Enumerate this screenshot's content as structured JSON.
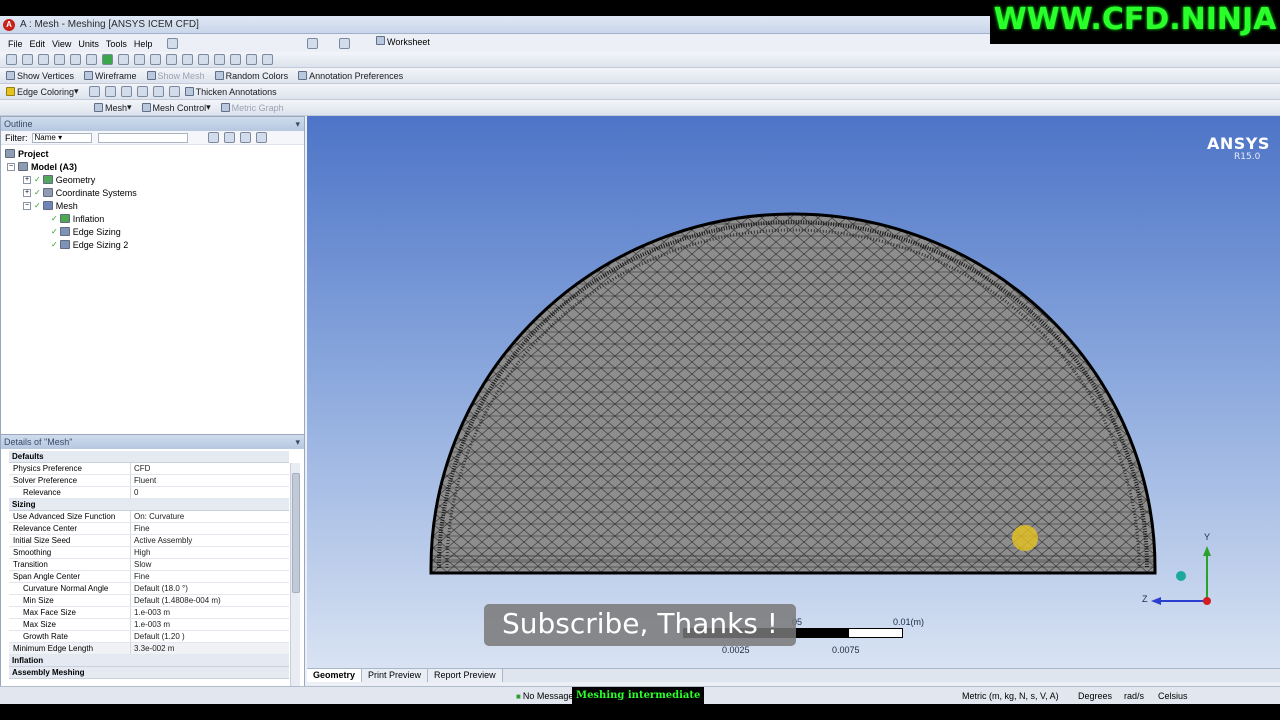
{
  "window": {
    "app_icon": "ansys-icon",
    "title": "A : Mesh - Meshing [ANSYS ICEM CFD]"
  },
  "watermark": "WWW.CFD.NINJA",
  "menu": [
    "File",
    "Edit",
    "View",
    "Units",
    "Tools",
    "Help"
  ],
  "worksheet_label": "Worksheet",
  "toolbar2": {
    "show_vertices": "Show Vertices",
    "wireframe": "Wireframe",
    "show_mesh": "Show Mesh",
    "random_colors": "Random Colors",
    "annotation_prefs": "Annotation Preferences"
  },
  "toolbar3": {
    "edge_coloring": "Edge Coloring",
    "thicken_annotations": "Thicken Annotations"
  },
  "toolbar4": {
    "mesh": "Mesh",
    "mesh_control": "Mesh Control",
    "metric_graph": "Metric Graph"
  },
  "outline": {
    "title": "Outline",
    "filter_label": "Filter:",
    "filter_value": "Name",
    "project": "Project",
    "model": "Model (A3)",
    "geometry": "Geometry",
    "coordinate_systems": "Coordinate Systems",
    "mesh": "Mesh",
    "children": [
      "Inflation",
      "Edge Sizing",
      "Edge Sizing 2"
    ]
  },
  "details": {
    "title": "Details of \"Mesh\"",
    "sections": {
      "defaults": "Defaults",
      "sizing": "Sizing",
      "inflation": "Inflation",
      "assembly": "Assembly Meshing"
    },
    "defaults_rows": [
      {
        "label": "Physics Preference",
        "value": "CFD"
      },
      {
        "label": "Solver Preference",
        "value": "Fluent"
      },
      {
        "label": "Relevance",
        "value": "0"
      }
    ],
    "sizing_rows": [
      {
        "label": "Use Advanced Size Function",
        "value": "On: Curvature"
      },
      {
        "label": "Relevance Center",
        "value": "Fine"
      },
      {
        "label": "Initial Size Seed",
        "value": "Active Assembly"
      },
      {
        "label": "Smoothing",
        "value": "High"
      },
      {
        "label": "Transition",
        "value": "Slow"
      },
      {
        "label": "Span Angle Center",
        "value": "Fine"
      },
      {
        "label": "Curvature Normal Angle",
        "value": "Default (18.0 °)"
      },
      {
        "label": "Min Size",
        "value": "Default (1.4808e-004 m)"
      },
      {
        "label": "Max Face Size",
        "value": "1.e-003 m"
      },
      {
        "label": "Max Size",
        "value": "1.e-003 m"
      },
      {
        "label": "Growth Rate",
        "value": "Default (1.20 )"
      },
      {
        "label": "Minimum Edge Length",
        "value": "3.3e-002 m"
      }
    ]
  },
  "viewport": {
    "logo": "ANSYS",
    "version": "R15.0",
    "subscribe": "Subscribe, Thanks !",
    "scale_labels": {
      "top_mid": "05",
      "top_right": "0.01(m)",
      "bottom_left": "0.0025",
      "bottom_right": "0.0075"
    },
    "axes": {
      "y": "Y",
      "z": "Z"
    }
  },
  "tabs": [
    "Geometry",
    "Print Preview",
    "Report Preview"
  ],
  "status": {
    "message": "No Messages",
    "meshing": "Meshing intermediate",
    "units": "Metric (m, kg, N, s, V, A)",
    "angle": "Degrees",
    "rate": "rad/s",
    "temperature": "Celsius"
  }
}
